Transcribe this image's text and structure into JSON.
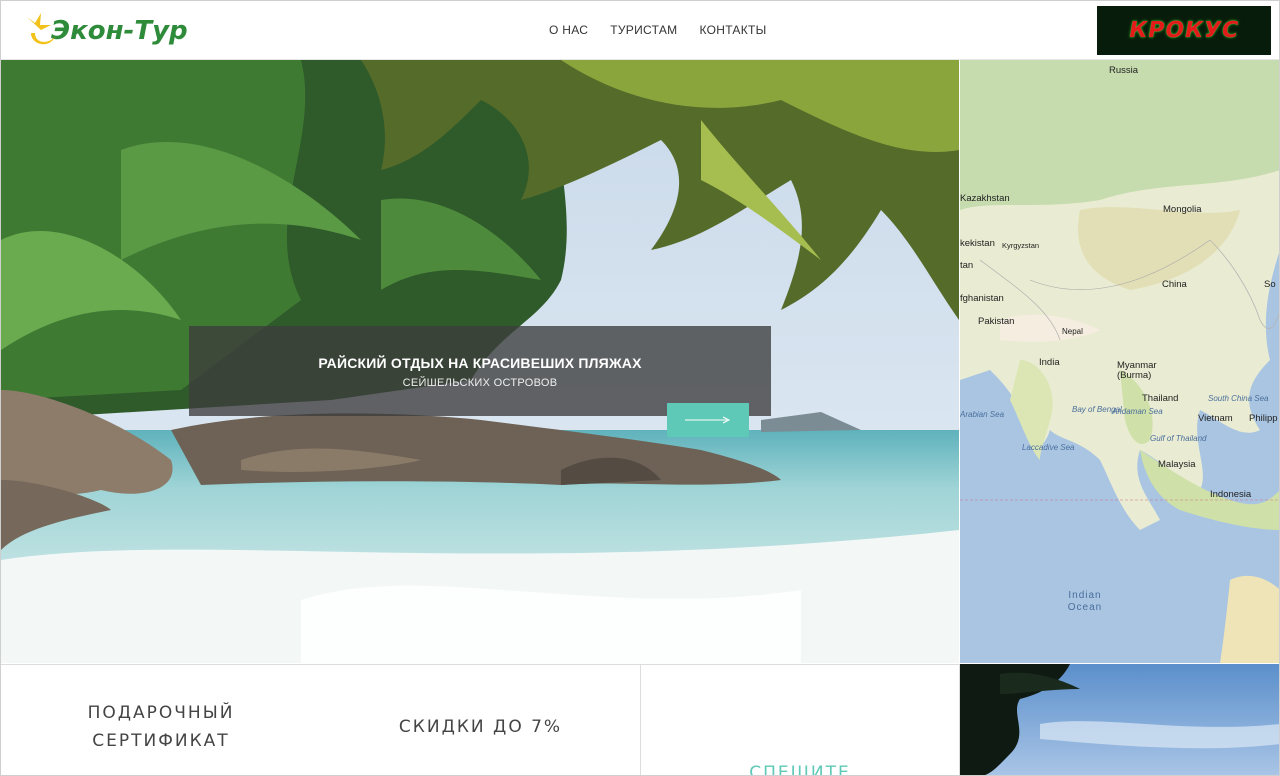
{
  "header": {
    "logo_text": "Экон-Тур",
    "nav": [
      "О НАС",
      "ТУРИСТАМ",
      "КОНТАКТЫ"
    ],
    "partner_logo_text": "КРОКУС"
  },
  "hero": {
    "title": "РАЙСКИЙ ОТДЫХ НА КРАСИВЕШИХ ПЛЯЖАХ",
    "subtitle": "СЕЙШЕЛЬСКИХ ОСТРОВОВ"
  },
  "map": {
    "countries": [
      "Russia",
      "Kazakhstan",
      "Mongolia",
      "kekistan",
      "Kyrgyzstan",
      "tan",
      "China",
      "fghanistan",
      "Pakistan",
      "Nepal",
      "India",
      "Myanmar (Burma)",
      "Thailand",
      "Vietnam",
      "Philipp",
      "Malaysia",
      "Indonesia",
      "So"
    ],
    "seas": [
      "Arabian Sea",
      "Bay of Bengal",
      "Andaman Sea",
      "Laccadive Sea",
      "Gulf of Thailand",
      "South China Sea"
    ],
    "ocean": "Indian Ocean"
  },
  "cards": [
    {
      "line1": "ПОДАРОЧНЫЙ",
      "line2": "СЕРТИФИКАТ"
    },
    {
      "line1": "СКИДКИ ДО 7%"
    },
    {
      "line1": "СПЕШИТЕ"
    }
  ],
  "colors": {
    "accent": "#5ec9b6",
    "logo_green": "#2e8b3a",
    "overlay": "#3c3c3c"
  }
}
